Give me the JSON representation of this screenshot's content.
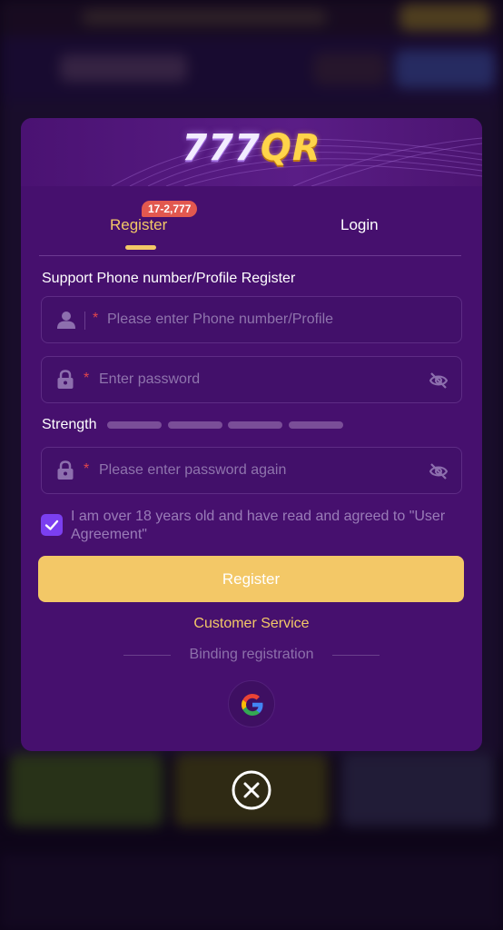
{
  "modal": {
    "logo": {
      "digits": "777",
      "letters": "QR"
    },
    "tabs": {
      "register_label": "Register",
      "register_badge": "17-2,777",
      "login_label": "Login"
    },
    "section_title": "Support Phone number/Profile Register",
    "fields": {
      "phone_placeholder": "Please enter Phone number/Profile",
      "password_placeholder": "Enter password",
      "confirm_password_placeholder": "Please enter password again",
      "required_mark": "*"
    },
    "strength": {
      "label": "Strength",
      "segments": 4
    },
    "agreement": {
      "checked": true,
      "text": "I am over 18 years old and have read and agreed to \"User Agreement\""
    },
    "register_button": "Register",
    "customer_service": "Customer Service",
    "binding_label": "Binding registration",
    "icons": {
      "user": "user-icon",
      "lock": "lock-icon",
      "eye_off": "eye-off-icon",
      "google": "google-icon",
      "close": "close-icon",
      "check": "check-icon"
    }
  },
  "colors": {
    "accent_gold": "#f3c867",
    "modal_bg": "#46106e",
    "badge_red": "#e2584f",
    "checkbox_purple": "#7b3ff0",
    "required_red": "#e2464c"
  }
}
